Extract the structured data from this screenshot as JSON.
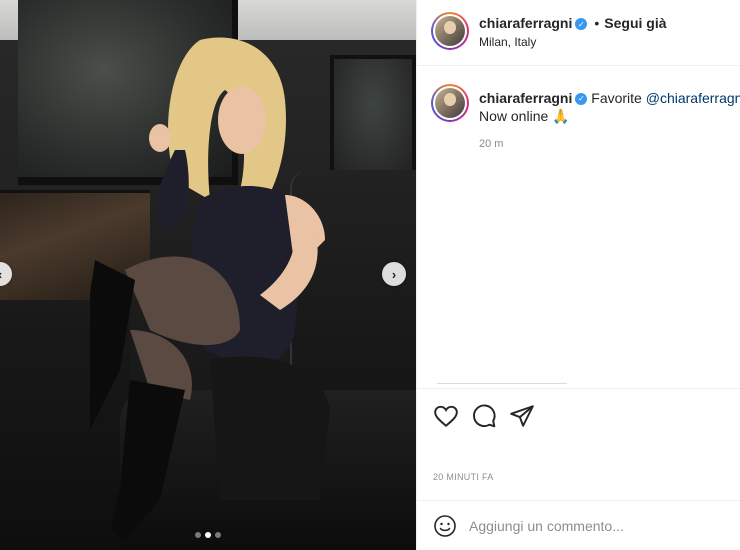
{
  "post": {
    "username": "chiaraferragni",
    "follow_label": "Segui già",
    "bullet": "•",
    "location": "Milan, Italy",
    "photo_alt": "photo",
    "carousel": {
      "count": 3,
      "active_index": 1
    }
  },
  "caption": {
    "username": "chiaraferragni",
    "text_prefix": "Favorite ",
    "mention": "@chiaraferragnibrand",
    "second_line": "Now online 🙏",
    "time": "20 m"
  },
  "actions": {
    "like_icon": "heart-icon",
    "comment_icon": "comment-icon",
    "share_icon": "paper-plane-icon"
  },
  "timestamp": "20 minuti fa",
  "comment": {
    "placeholder": "Aggiungi un commento...",
    "emoji_icon": "smiley-icon"
  },
  "colors": {
    "verified": "#3897f0",
    "mention": "#00376b",
    "muted": "#8e8e8e",
    "text": "#262626"
  }
}
